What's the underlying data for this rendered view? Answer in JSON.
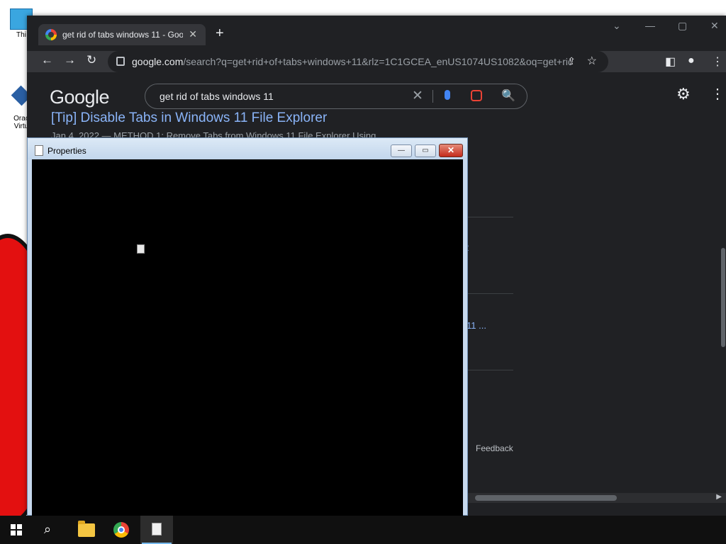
{
  "desktop": {
    "icons": [
      {
        "label": "Thi",
        "name": "this-pc"
      },
      {
        "label": "Orac\nVirtu",
        "name": "oracle-virtualbox"
      }
    ]
  },
  "chrome": {
    "tab_title": "get rid of tabs windows 11 - Goo",
    "tab_close": "✕",
    "new_tab": "+",
    "window_controls": {
      "dropdown": "⌄",
      "minimize": "—",
      "maximize": "▢",
      "close": "✕"
    },
    "nav": {
      "back": "←",
      "forward": "→",
      "reload": "↻"
    },
    "url_host": "google.com",
    "url_path": "/search?q=get+rid+of+tabs+windows+11&rlz=1C1GCEA_enUS1074US1082&oq=get+rid+of...",
    "omnibox_icons": {
      "share": "⇪",
      "star": "☆"
    },
    "toolbar_icons": {
      "sidepanel": "◧",
      "profile": "●",
      "menu": "⋮"
    },
    "google": {
      "logo": "Google",
      "query": "get rid of tabs windows 11",
      "clear": "✕",
      "search_icon": "🔍",
      "gear": "⚙",
      "apps": "⋮⋮⋮"
    },
    "result": {
      "title": "[Tip] Disable Tabs in Windows 11 File Explorer",
      "snippet": "Jan 4, 2022 — METHOD 1: Remove Tabs from Windows 11 File Explorer Using ..."
    },
    "fragments": {
      "frag_2": "2",
      "frag_11": "11 ..."
    },
    "feedback": "Feedback",
    "scroll_arrow": "▶"
  },
  "properties": {
    "title": "Properties",
    "minimize": "—",
    "maximize": "▭",
    "close": "✕"
  },
  "colors": {
    "chrome_bg": "#202124",
    "link": "#8ab4f8",
    "desktop_red": "#e31010",
    "taskbar": "#101010"
  }
}
